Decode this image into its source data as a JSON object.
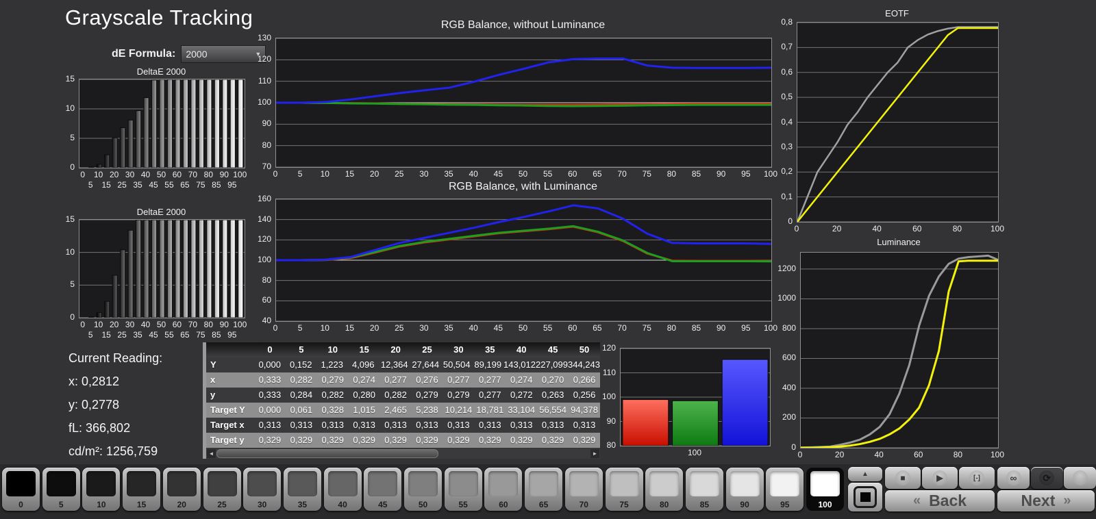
{
  "header": {
    "title": "Grayscale Tracking",
    "de_formula_label": "dE Formula:",
    "de_formula_value": "2000"
  },
  "current_reading": {
    "label": "Current Reading:",
    "lines": [
      "x: 0,2812",
      "y: 0,2778",
      "fL: 366,802",
      "cd/m²: 1256,759"
    ]
  },
  "table": {
    "columns": [
      "0",
      "5",
      "10",
      "15",
      "20",
      "25",
      "30",
      "35",
      "40",
      "45",
      "50"
    ],
    "rows": [
      {
        "label": "Y",
        "values": [
          "0,000",
          "0,152",
          "1,223",
          "4,096",
          "12,364",
          "27,644",
          "50,504",
          "89,199",
          "143,012",
          "227,099",
          "344,243"
        ]
      },
      {
        "label": "x",
        "values": [
          "0,333",
          "0,282",
          "0,279",
          "0,274",
          "0,277",
          "0,276",
          "0,277",
          "0,277",
          "0,274",
          "0,270",
          "0,266"
        ]
      },
      {
        "label": "y",
        "values": [
          "0,333",
          "0,284",
          "0,282",
          "0,280",
          "0,282",
          "0,279",
          "0,279",
          "0,277",
          "0,272",
          "0,263",
          "0,256"
        ]
      },
      {
        "label": "Target Y",
        "values": [
          "0,000",
          "0,061",
          "0,328",
          "1,015",
          "2,465",
          "5,238",
          "10,214",
          "18,781",
          "33,104",
          "56,554",
          "94,378"
        ]
      },
      {
        "label": "Target x",
        "values": [
          "0,313",
          "0,313",
          "0,313",
          "0,313",
          "0,313",
          "0,313",
          "0,313",
          "0,313",
          "0,313",
          "0,313",
          "0,313"
        ]
      },
      {
        "label": "Target y",
        "values": [
          "0,329",
          "0,329",
          "0,329",
          "0,329",
          "0,329",
          "0,329",
          "0,329",
          "0,329",
          "0,329",
          "0,329",
          "0,329"
        ]
      }
    ]
  },
  "swatches": {
    "labels": [
      "0",
      "5",
      "10",
      "15",
      "20",
      "25",
      "30",
      "35",
      "40",
      "45",
      "50",
      "55",
      "60",
      "65",
      "70",
      "75",
      "80",
      "85",
      "90",
      "95",
      "100"
    ],
    "selected": "100"
  },
  "controls": {
    "back_label": "Back",
    "next_label": "Next",
    "back_chevron": "«",
    "next_chevron": "»",
    "up_glyph": "▲",
    "square_stop": "■",
    "icons": [
      {
        "name": "stop-icon",
        "glyph": "■",
        "dark": false
      },
      {
        "name": "play-icon",
        "glyph": "▶",
        "dark": false
      },
      {
        "name": "interval-icon",
        "glyph": "[-]",
        "dark": false
      },
      {
        "name": "infinity-icon",
        "glyph": "∞",
        "dark": false
      },
      {
        "name": "refresh-icon",
        "glyph": "⟳",
        "dark": true
      },
      {
        "name": "blank-icon",
        "glyph": "",
        "dark": false
      }
    ]
  },
  "colors": {
    "red": "#e02810",
    "green": "#1e9e1e",
    "blue": "#2222ee",
    "yellow": "#f2f20a",
    "gray": "#a0a0a0"
  },
  "chart_data": [
    {
      "id": "deltae-top",
      "type": "bar",
      "title": "DeltaE 2000",
      "categories": [
        0,
        5,
        10,
        15,
        20,
        25,
        30,
        35,
        40,
        45,
        50,
        55,
        60,
        65,
        70,
        75,
        80,
        85,
        90,
        95,
        100
      ],
      "values": [
        0,
        0.1,
        0.6,
        2.2,
        5.1,
        6.8,
        8.1,
        9.7,
        11.9,
        14.9,
        15,
        15,
        15,
        15,
        15,
        15,
        15,
        15,
        15,
        15,
        15
      ],
      "ylim": [
        0,
        15
      ],
      "yticks": [
        0,
        5,
        10,
        15
      ],
      "bar_style": "grayscale-ramp",
      "two_row_labels": true
    },
    {
      "id": "deltae-bottom",
      "type": "bar",
      "title": "DeltaE 2000",
      "categories": [
        0,
        5,
        10,
        15,
        20,
        25,
        30,
        35,
        40,
        45,
        50,
        55,
        60,
        65,
        70,
        75,
        80,
        85,
        90,
        95,
        100
      ],
      "values": [
        0,
        0.1,
        0.8,
        2.5,
        6.5,
        10.4,
        13.4,
        15,
        15,
        15,
        15,
        15,
        15,
        15,
        15,
        15,
        15,
        15,
        15,
        15,
        15
      ],
      "ylim": [
        0,
        15
      ],
      "yticks": [
        0,
        5,
        10,
        15
      ],
      "bar_style": "grayscale-ramp",
      "two_row_labels": true
    },
    {
      "id": "rgb-without",
      "type": "line",
      "title": "RGB Balance, without Luminance",
      "x": [
        0,
        5,
        10,
        15,
        20,
        25,
        30,
        35,
        40,
        45,
        50,
        55,
        60,
        65,
        70,
        75,
        80,
        85,
        90,
        95,
        100
      ],
      "xlim": [
        0,
        100
      ],
      "ylim": [
        70,
        130
      ],
      "yticks": [
        70,
        80,
        90,
        100,
        110,
        120,
        130
      ],
      "xticks": [
        0,
        5,
        10,
        15,
        20,
        25,
        30,
        35,
        40,
        45,
        50,
        55,
        60,
        65,
        70,
        75,
        80,
        85,
        90,
        95,
        100
      ],
      "emphasize": 100,
      "grid": true,
      "legend": "none",
      "series": [
        {
          "name": "red",
          "color": "#e02810",
          "values": [
            100,
            100,
            99.9,
            99.8,
            99.7,
            99.5,
            99.4,
            99.3,
            99.2,
            99.1,
            99.0,
            99.0,
            99.0,
            99.1,
            99.2,
            99.3,
            99.4,
            99.5,
            99.5,
            99.5,
            99.5
          ]
        },
        {
          "name": "green",
          "color": "#1e9e1e",
          "values": [
            100,
            100,
            99.9,
            99.7,
            99.6,
            99.4,
            99.3,
            99.1,
            99.0,
            98.8,
            98.7,
            98.5,
            98.4,
            98.5,
            98.6,
            98.8,
            98.9,
            99.0,
            99.0,
            99.0,
            99.0
          ]
        },
        {
          "name": "blue",
          "color": "#2222ee",
          "values": [
            100,
            100,
            100.3,
            101.5,
            103,
            104.5,
            105.8,
            107,
            109.8,
            113,
            115.8,
            118.8,
            120.3,
            120.6,
            120.6,
            117.3,
            116.3,
            116.2,
            116.2,
            116.2,
            116.3
          ]
        }
      ]
    },
    {
      "id": "rgb-with",
      "type": "line",
      "title": "RGB Balance, with Luminance",
      "x": [
        0,
        5,
        10,
        15,
        20,
        25,
        30,
        35,
        40,
        45,
        50,
        55,
        60,
        65,
        70,
        75,
        80,
        85,
        90,
        95,
        100
      ],
      "xlim": [
        0,
        100
      ],
      "ylim": [
        40,
        160
      ],
      "yticks": [
        40,
        60,
        80,
        100,
        120,
        140,
        160
      ],
      "xticks": [
        0,
        5,
        10,
        15,
        20,
        25,
        30,
        35,
        40,
        45,
        50,
        55,
        60,
        65,
        70,
        75,
        80,
        85,
        90,
        95,
        100
      ],
      "emphasize": 100,
      "grid": true,
      "legend": "none",
      "series": [
        {
          "name": "red",
          "color": "#e02810",
          "values": [
            100,
            100,
            100.2,
            102,
            107.5,
            113.5,
            117.5,
            120.5,
            123.5,
            126.5,
            128.5,
            130.5,
            133,
            127.5,
            119,
            106.5,
            99.5,
            99.3,
            99.3,
            99.3,
            99.2
          ]
        },
        {
          "name": "green",
          "color": "#1e9e1e",
          "values": [
            100,
            100,
            100.3,
            102.5,
            108,
            114,
            118,
            121,
            124,
            127,
            129,
            131,
            133.5,
            128,
            119.5,
            107,
            99,
            99,
            99,
            99,
            98.8
          ]
        },
        {
          "name": "blue",
          "color": "#2222ee",
          "values": [
            100,
            100,
            100.5,
            103,
            110,
            117,
            122,
            127,
            132,
            137.5,
            142.5,
            148,
            154,
            151,
            141,
            126,
            117,
            116.5,
            116.5,
            116.5,
            116
          ]
        }
      ]
    },
    {
      "id": "eotf",
      "type": "line",
      "title": "EOTF",
      "x": [
        0,
        5,
        10,
        15,
        20,
        25,
        30,
        35,
        40,
        45,
        50,
        55,
        60,
        65,
        70,
        75,
        80,
        85,
        90,
        95,
        100
      ],
      "xlim": [
        0,
        100
      ],
      "ylim": [
        0,
        0.8
      ],
      "yticks": [
        0,
        0.1,
        0.2,
        0.3,
        0.4,
        0.5,
        0.6,
        0.7,
        0.8
      ],
      "ytick_labels": [
        "0",
        "0,1",
        "0,2",
        "0,3",
        "0,4",
        "0,5",
        "0,6",
        "0,7",
        "0,8"
      ],
      "xticks": [
        0,
        20,
        40,
        60,
        80,
        100
      ],
      "grid": true,
      "legend": "none",
      "lw": 2.5,
      "series": [
        {
          "name": "measured",
          "color": "#a0a0a0",
          "values": [
            0,
            0.1,
            0.2,
            0.26,
            0.32,
            0.39,
            0.44,
            0.5,
            0.55,
            0.6,
            0.64,
            0.7,
            0.73,
            0.752,
            0.766,
            0.776,
            0.782,
            0.782,
            0.782,
            0.782,
            0.782
          ]
        },
        {
          "name": "target",
          "color": "#f2f20a",
          "values": [
            0,
            0.05,
            0.1,
            0.15,
            0.2,
            0.25,
            0.3,
            0.35,
            0.4,
            0.45,
            0.5,
            0.55,
            0.6,
            0.65,
            0.7,
            0.75,
            0.778,
            0.778,
            0.778,
            0.778,
            0.778
          ]
        }
      ]
    },
    {
      "id": "luminance",
      "type": "line",
      "title": "Luminance",
      "x": [
        0,
        5,
        10,
        15,
        20,
        25,
        30,
        35,
        40,
        45,
        50,
        55,
        60,
        65,
        70,
        75,
        80,
        85,
        90,
        95,
        100
      ],
      "xlim": [
        0,
        100
      ],
      "ylim": [
        0,
        1310
      ],
      "yticks": [
        0,
        200,
        400,
        600,
        800,
        1000,
        1200
      ],
      "xticks": [
        0,
        20,
        40,
        60,
        80,
        100
      ],
      "grid": true,
      "legend": "none",
      "lw": 3,
      "series": [
        {
          "name": "measured",
          "color": "#9a9a9a",
          "values": [
            2,
            3,
            5,
            8,
            20,
            35,
            55,
            90,
            140,
            225,
            365,
            555,
            820,
            1020,
            1150,
            1235,
            1270,
            1280,
            1285,
            1290,
            1262
          ]
        },
        {
          "name": "target",
          "color": "#f2f20a",
          "values": [
            0,
            0,
            2,
            4,
            8,
            15,
            25,
            40,
            60,
            90,
            130,
            190,
            270,
            420,
            650,
            1050,
            1252,
            1256,
            1256,
            1256,
            1256
          ]
        }
      ]
    },
    {
      "id": "rgb-bars",
      "type": "bar",
      "title": "",
      "categories": [
        "R",
        "G",
        "B"
      ],
      "values": [
        99,
        98.5,
        115.5
      ],
      "gradients": [
        [
          "#ff6f5e",
          "#c80f00"
        ],
        [
          "#4db34d",
          "#0f7a12"
        ],
        [
          "#5858ff",
          "#1212d8"
        ]
      ],
      "ylim": [
        80,
        120
      ],
      "yticks": [
        80,
        90,
        100,
        110,
        120
      ],
      "xlabel": "100",
      "bar_style": "rgb"
    }
  ]
}
